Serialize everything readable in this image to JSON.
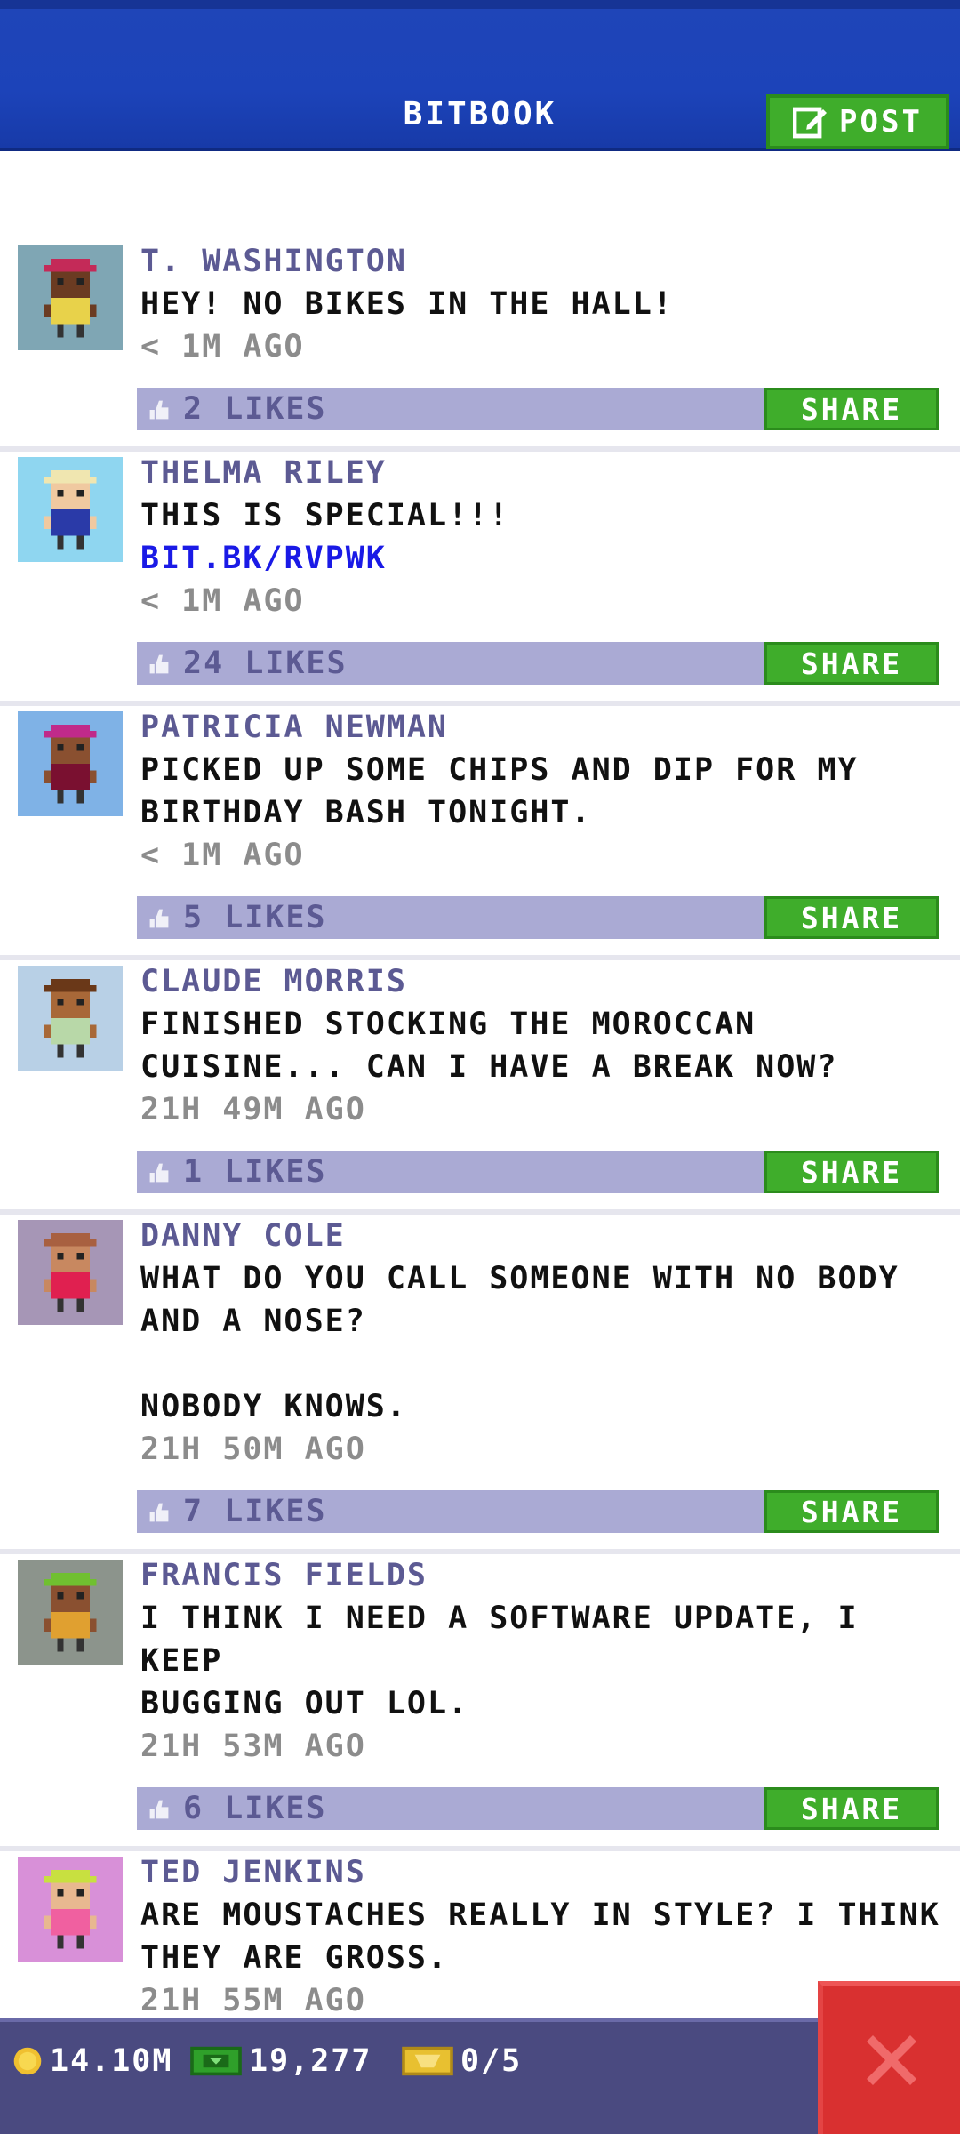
{
  "header": {
    "title": "BITBOOK",
    "post_label": "POST"
  },
  "posts": [
    {
      "author": "T. WASHINGTON",
      "lines": [
        "HEY! NO BIKES IN THE HALL!"
      ],
      "link": "",
      "time": "< 1M AGO",
      "likes": "2 LIKES",
      "avatar_bg": "#7fa6b4",
      "shirt": "#e8d24a",
      "hat": "#c42a58",
      "skin": "#6b3b22"
    },
    {
      "author": "THELMA RILEY",
      "lines": [
        "THIS IS SPECIAL!!!"
      ],
      "link": "BIT.BK/RVPWK",
      "time": "< 1M AGO",
      "likes": "24 LIKES",
      "avatar_bg": "#8fd6f0",
      "shirt": "#2a3aa8",
      "hat": "#f0e6b0",
      "skin": "#f0c9a0"
    },
    {
      "author": "PATRICIA NEWMAN",
      "lines": [
        "PICKED UP SOME CHIPS AND DIP FOR MY",
        "BIRTHDAY BASH TONIGHT."
      ],
      "link": "",
      "time": "< 1M AGO",
      "likes": "5 LIKES",
      "avatar_bg": "#7fb2e6",
      "shirt": "#7a1030",
      "hat": "#c02a8a",
      "skin": "#8a5030"
    },
    {
      "author": "CLAUDE MORRIS",
      "lines": [
        "FINISHED STOCKING THE MOROCCAN",
        "CUISINE... CAN I HAVE A BREAK NOW?"
      ],
      "link": "",
      "time": "21H 49M AGO",
      "likes": "1 LIKES",
      "avatar_bg": "#b8d0e6",
      "shirt": "#b8d8a8",
      "hat": "#6a3818",
      "skin": "#a86838"
    },
    {
      "author": "DANNY COLE",
      "lines": [
        "WHAT DO YOU CALL SOMEONE WITH NO BODY",
        "AND A NOSE?",
        "",
        "NOBODY KNOWS."
      ],
      "link": "",
      "time": "21H 50M AGO",
      "likes": "7 LIKES",
      "avatar_bg": "#a696b6",
      "shirt": "#e02050",
      "hat": "#a86040",
      "skin": "#c88860"
    },
    {
      "author": "FRANCIS FIELDS",
      "lines": [
        "I THINK I NEED A SOFTWARE UPDATE, I KEEP",
        "BUGGING OUT LOL."
      ],
      "link": "",
      "time": "21H 53M AGO",
      "likes": "6 LIKES",
      "avatar_bg": "#8c948c",
      "shirt": "#e0a030",
      "hat": "#70c030",
      "skin": "#8a5030"
    },
    {
      "author": "TED JENKINS",
      "lines": [
        "ARE MOUSTACHES REALLY IN STYLE? I THINK",
        "THEY ARE GROSS."
      ],
      "link": "",
      "time": "21H 55M AGO",
      "likes": "",
      "avatar_bg": "#d890d8",
      "shirt": "#f060a0",
      "hat": "#c8e040",
      "skin": "#e8b890"
    }
  ],
  "share_label": "SHARE",
  "bottom": {
    "coins": "14.10M",
    "bux": "19,277",
    "tickets": "0/5"
  },
  "colors": {
    "header": "#1c43b9",
    "green": "#3fad2b",
    "likes_bar": "#aaaad4",
    "author": "#5c5a93",
    "close": "#d93030"
  }
}
